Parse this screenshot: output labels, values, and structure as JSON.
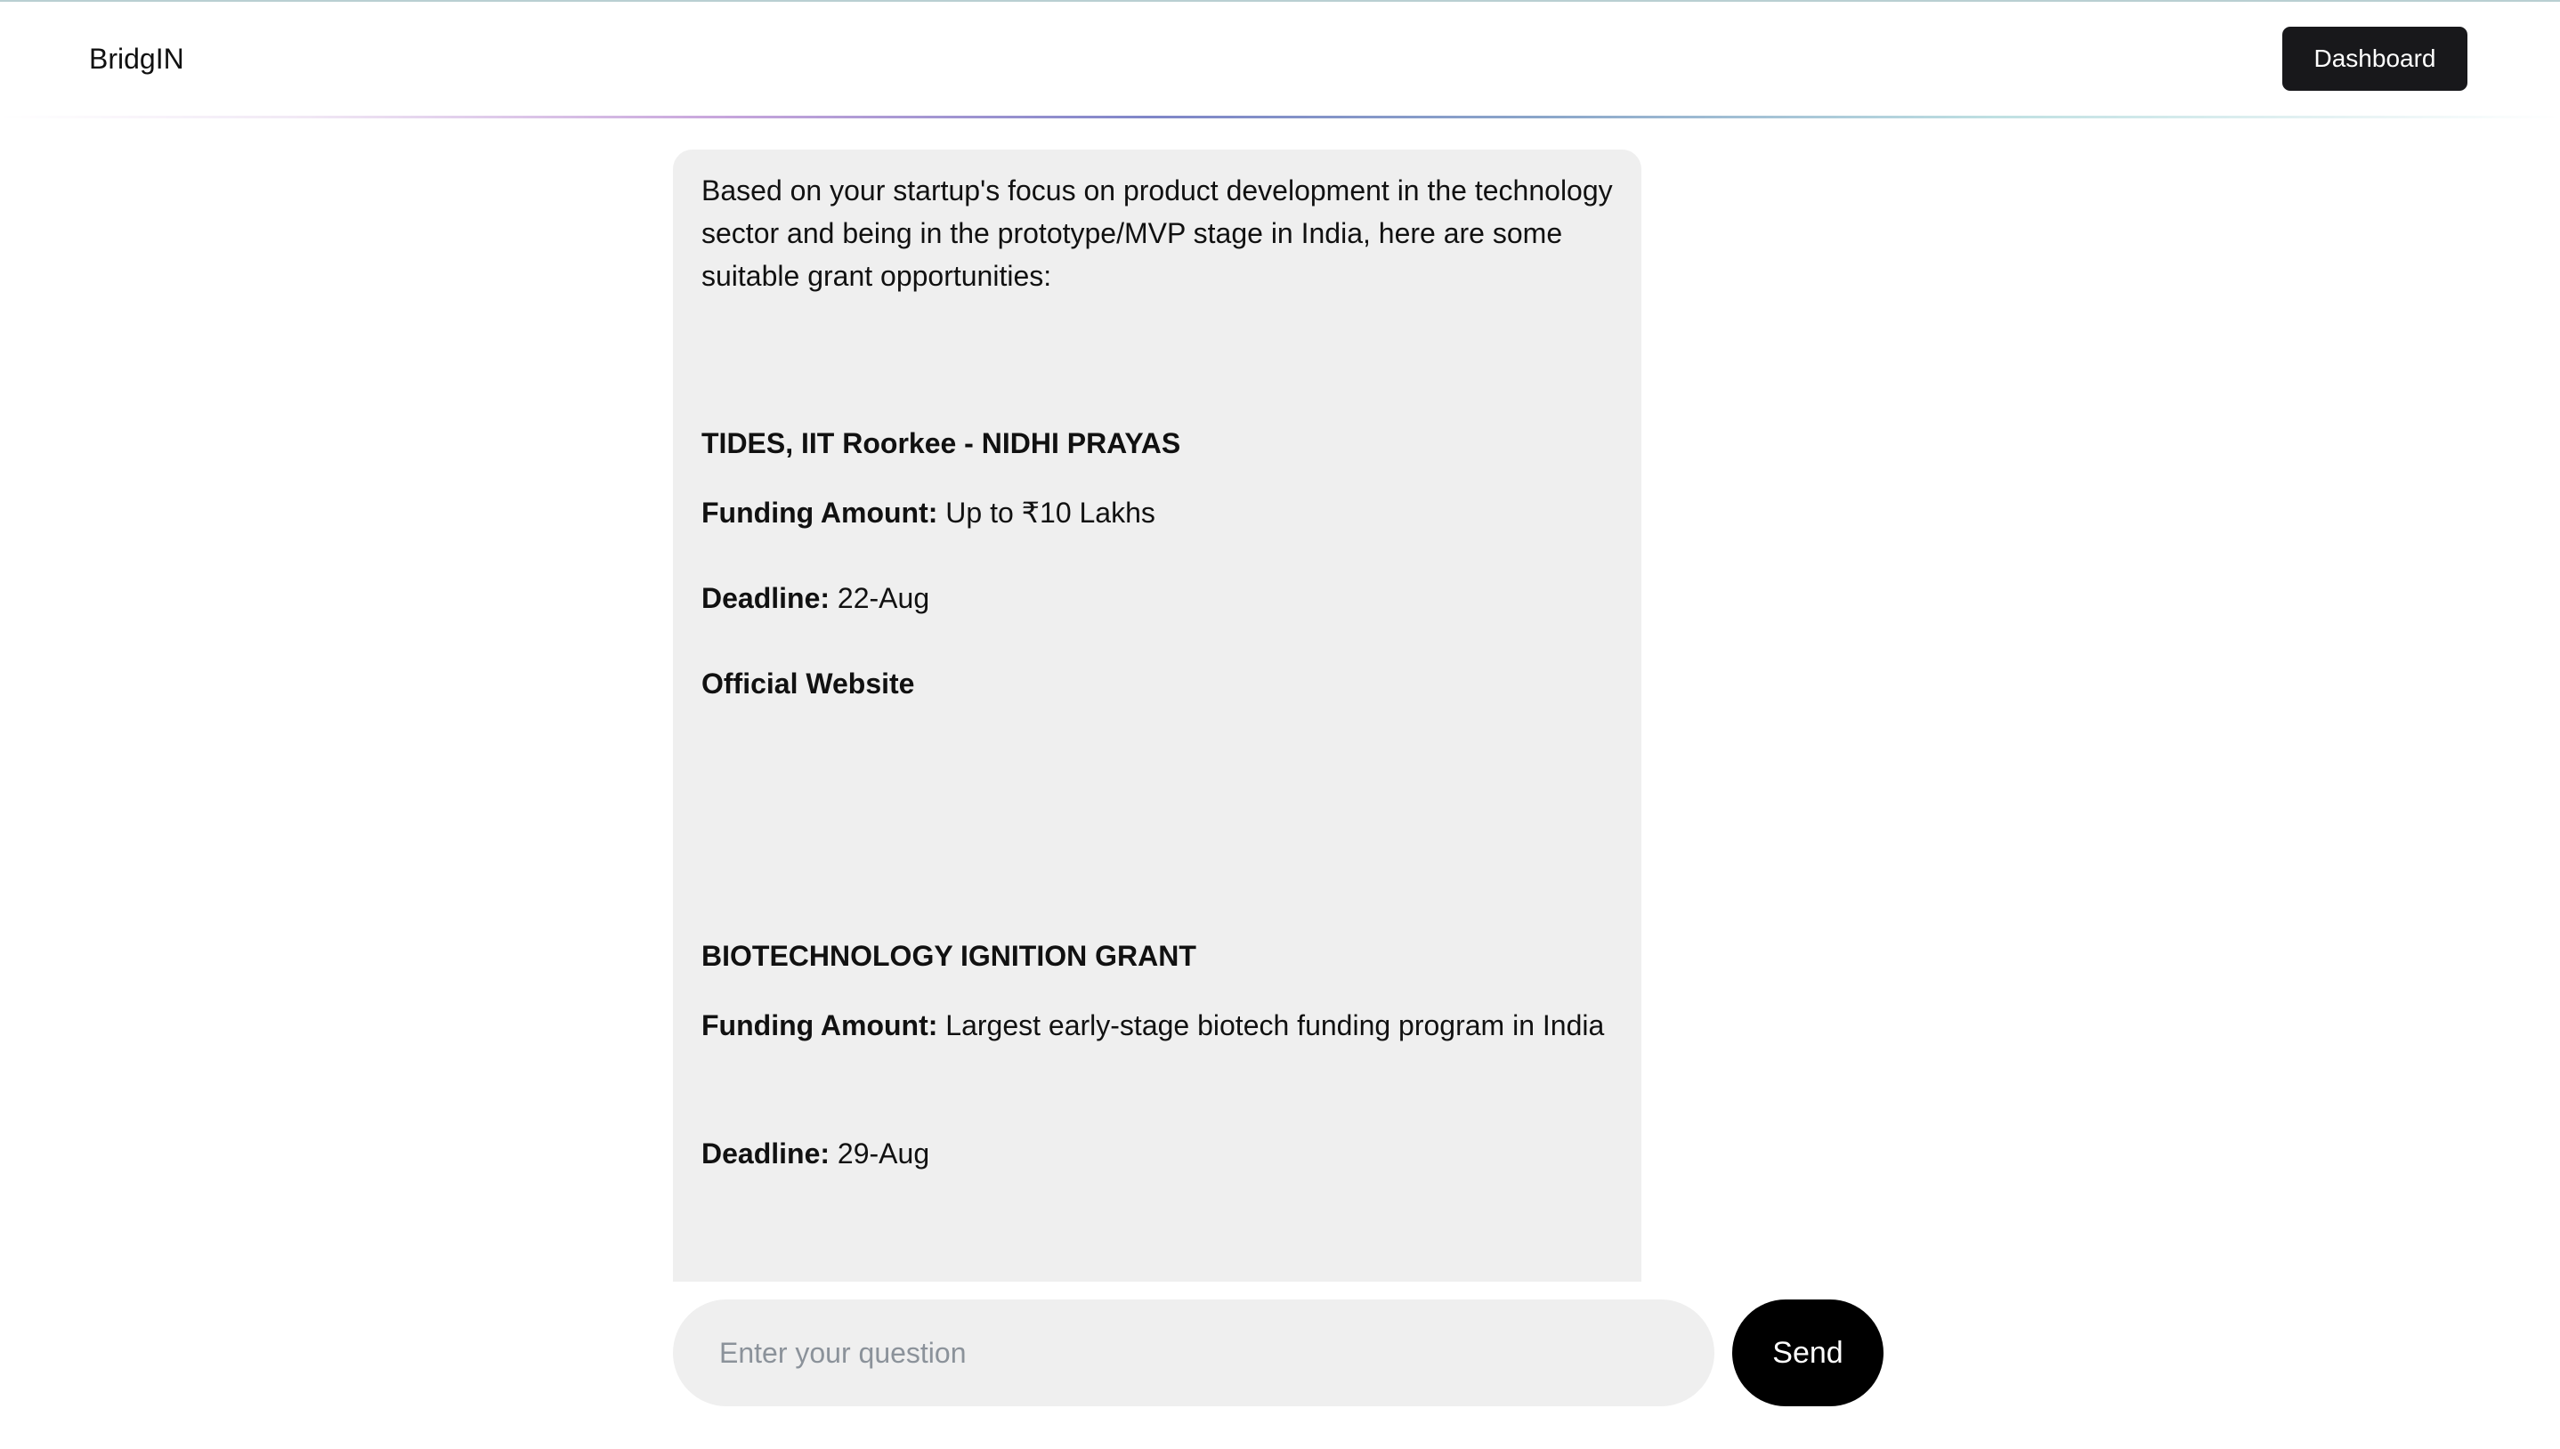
{
  "header": {
    "brand": "BridgIN",
    "dashboard_label": "Dashboard"
  },
  "chat": {
    "intro": "Based on your startup's focus on product development in the technology sector and being in the prototype/MVP stage in India, here are some suitable grant opportunities:",
    "grants": [
      {
        "title": "TIDES, IIT Roorkee - NIDHI PRAYAS",
        "funding_label": "Funding Amount:",
        "funding_value": " Up to ₹10 Lakhs",
        "deadline_label": "Deadline:",
        "deadline_value": " 22-Aug",
        "website_label": "Official Website"
      },
      {
        "title": "BIOTECHNOLOGY IGNITION GRANT",
        "funding_label": "Funding Amount:",
        "funding_value": " Largest early-stage biotech funding program in India",
        "deadline_label": "Deadline:",
        "deadline_value": " 29-Aug"
      }
    ]
  },
  "composer": {
    "placeholder": "Enter your question",
    "value": "",
    "send_label": "Send"
  },
  "colors": {
    "panel_background": "#efefef",
    "primary_button": "#18181b",
    "send_button": "#000000",
    "placeholder": "#8b929a"
  }
}
